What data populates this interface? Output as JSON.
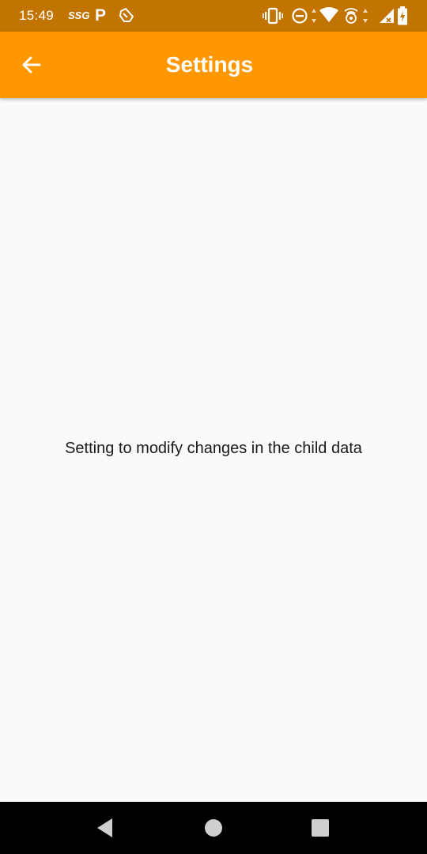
{
  "status_bar": {
    "time": "15:49",
    "carrier_badge": "SSG",
    "p_badge": "P"
  },
  "app_bar": {
    "title": "Settings"
  },
  "main": {
    "text": "Setting to modify changes in the child data"
  },
  "colors": {
    "status_bar": "#c27400",
    "app_bar": "#ff9800",
    "background": "#fafafa",
    "nav_bar": "#000000"
  },
  "icons": {
    "back": "arrow-back-icon",
    "nav_back": "triangle-back-icon",
    "nav_home": "circle-home-icon",
    "nav_recents": "square-recents-icon"
  }
}
